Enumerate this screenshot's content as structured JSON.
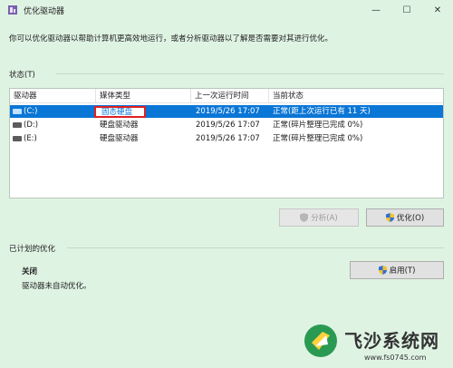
{
  "window": {
    "title": "优化驱动器",
    "min_glyph": "—",
    "max_glyph": "☐",
    "close_glyph": "✕"
  },
  "description": "你可以优化驱动器以帮助计算机更高效地运行，或者分析驱动器以了解是否需要对其进行优化。",
  "status_section": {
    "label": "状态(T)"
  },
  "listview": {
    "columns": [
      "驱动器",
      "媒体类型",
      "上一次运行时间",
      "当前状态"
    ],
    "rows": [
      {
        "drive": "(C:)",
        "media": "固态硬盘",
        "last_run": "2019/5/26 17:07",
        "status": "正常(距上次运行已有 11 天)",
        "selected": true
      },
      {
        "drive": "(D:)",
        "media": "硬盘驱动器",
        "last_run": "2019/5/26 17:07",
        "status": "正常(碎片整理已完成 0%)",
        "selected": false
      },
      {
        "drive": "(E:)",
        "media": "硬盘驱动器",
        "last_run": "2019/5/26 17:07",
        "status": "正常(碎片整理已完成 0%)",
        "selected": false
      }
    ]
  },
  "buttons": {
    "analyze": "分析(A)",
    "optimize": "优化(O)",
    "enable": "启用(T)"
  },
  "scheduled": {
    "label": "已计划的优化",
    "state": "关闭",
    "detail": "驱动器未自动优化。"
  },
  "watermark": {
    "cn": "飞沙系统网",
    "url": "www.fs0745.com"
  },
  "colors": {
    "background": "#dff3e3",
    "selection": "#0a76d6",
    "highlight_border": "#e02020"
  }
}
